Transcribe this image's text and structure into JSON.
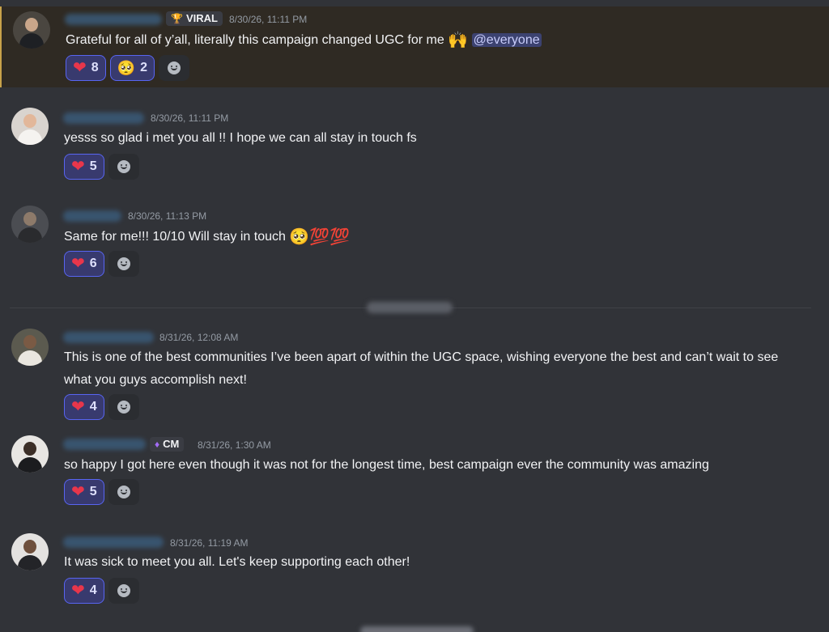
{
  "messages": [
    {
      "badge_icon": "trophy-icon",
      "badge": "VIRAL",
      "timestamp": "8/30/26, 11:11 PM",
      "text": "Grateful for all of y’all, literally this campaign changed UGC for me",
      "text_emoji": "🙌",
      "mention": "@everyone",
      "reactions": [
        {
          "emoji": "heart",
          "count": "8"
        },
        {
          "emoji": "pleading-face",
          "count": "2"
        }
      ]
    },
    {
      "timestamp": "8/30/26, 11:11 PM",
      "text": "yesss so glad i met you all !! I hope we can all stay in touch fs",
      "reactions": [
        {
          "emoji": "heart",
          "count": "5"
        }
      ]
    },
    {
      "timestamp": "8/30/26, 11:13 PM",
      "text": "Same for me!!! 10/10 Will stay in touch",
      "text_emoji": "🥺💯💯",
      "reactions": [
        {
          "emoji": "heart",
          "count": "6"
        }
      ]
    },
    {
      "timestamp": "8/31/26, 12:08 AM",
      "text": "This is one of the best communities I’ve been apart of within the UGC space, wishing everyone the best and can’t wait to see what you guys accomplish next!",
      "reactions": [
        {
          "emoji": "heart",
          "count": "4"
        }
      ]
    },
    {
      "badge_icon": "purple-flame-icon",
      "badge": "CM",
      "timestamp": "8/31/26, 1:30 AM",
      "text": "so happy I got here even though it was not for the longest time, best campaign ever the community was amazing",
      "reactions": [
        {
          "emoji": "heart",
          "count": "5"
        }
      ]
    },
    {
      "timestamp": "8/31/26, 11:19 AM",
      "text": "It was sick to meet you all. Let's keep supporting each other!",
      "reactions": [
        {
          "emoji": "heart",
          "count": "4"
        }
      ]
    }
  ],
  "colors": {
    "background": "#313338",
    "highlight_background": "#2f2a23",
    "reaction_active_bg": "#383a6e",
    "reaction_active_border": "#5865f2",
    "heart": "#e8364b",
    "mention_bg": "#3c4270"
  }
}
